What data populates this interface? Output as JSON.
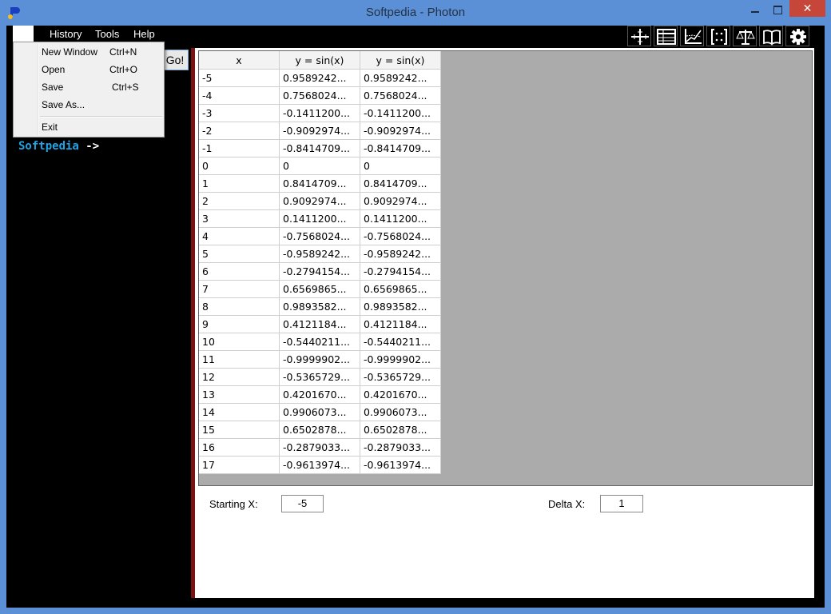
{
  "window": {
    "title": "Softpedia - Photon",
    "close_glyph": "✕"
  },
  "menubar": {
    "items": [
      "History",
      "Tools",
      "Help"
    ]
  },
  "file_menu": {
    "items": [
      {
        "label": "New Window",
        "shortcut": "Ctrl+N"
      },
      {
        "label": "Open",
        "shortcut": "Ctrl+O"
      },
      {
        "label": "Save",
        "shortcut": "Ctrl+S"
      },
      {
        "label": "Save As...",
        "shortcut": ""
      },
      {
        "label": "Exit",
        "shortcut": ""
      }
    ]
  },
  "left_panel": {
    "go_label": "Go!",
    "prompt_name": "Softpedia",
    "prompt_arrow": "->"
  },
  "toolbar": {
    "icons": [
      "crosshair-axes-icon",
      "table-icon",
      "graph-icon",
      "matrix-icon",
      "scale-icon",
      "book-icon",
      "gear-icon"
    ]
  },
  "table": {
    "headers": [
      "x",
      "y = sin(x)",
      "y = sin(x)"
    ],
    "rows": [
      [
        "-5",
        "0.9589242...",
        "0.9589242..."
      ],
      [
        "-4",
        "0.7568024...",
        "0.7568024..."
      ],
      [
        "-3",
        "-0.1411200...",
        "-0.1411200..."
      ],
      [
        "-2",
        "-0.9092974...",
        "-0.9092974..."
      ],
      [
        "-1",
        "-0.8414709...",
        "-0.8414709..."
      ],
      [
        "0",
        "0",
        "0"
      ],
      [
        "1",
        "0.8414709...",
        "0.8414709..."
      ],
      [
        "2",
        "0.9092974...",
        "0.9092974..."
      ],
      [
        "3",
        "0.1411200...",
        "0.1411200..."
      ],
      [
        "4",
        "-0.7568024...",
        "-0.7568024..."
      ],
      [
        "5",
        "-0.9589242...",
        "-0.9589242..."
      ],
      [
        "6",
        "-0.2794154...",
        "-0.2794154..."
      ],
      [
        "7",
        "0.6569865...",
        "0.6569865..."
      ],
      [
        "8",
        "0.9893582...",
        "0.9893582..."
      ],
      [
        "9",
        "0.4121184...",
        "0.4121184..."
      ],
      [
        "10",
        "-0.5440211...",
        "-0.5440211..."
      ],
      [
        "11",
        "-0.9999902...",
        "-0.9999902..."
      ],
      [
        "12",
        "-0.5365729...",
        "-0.5365729..."
      ],
      [
        "13",
        "0.4201670...",
        "0.4201670..."
      ],
      [
        "14",
        "0.9906073...",
        "0.9906073..."
      ],
      [
        "15",
        "0.6502878...",
        "0.6502878..."
      ],
      [
        "16",
        "-0.2879033...",
        "-0.2879033..."
      ],
      [
        "17",
        "-0.9613974...",
        "-0.9613974..."
      ]
    ]
  },
  "controls": {
    "starting_x_label": "Starting X:",
    "starting_x_value": "-5",
    "delta_x_label": "Delta X:",
    "delta_x_value": "1"
  },
  "colors": {
    "titlebar": "#5b8fd6",
    "prompt_accent": "#21a3e6",
    "divider": "#7a1212",
    "close": "#c7463a"
  }
}
